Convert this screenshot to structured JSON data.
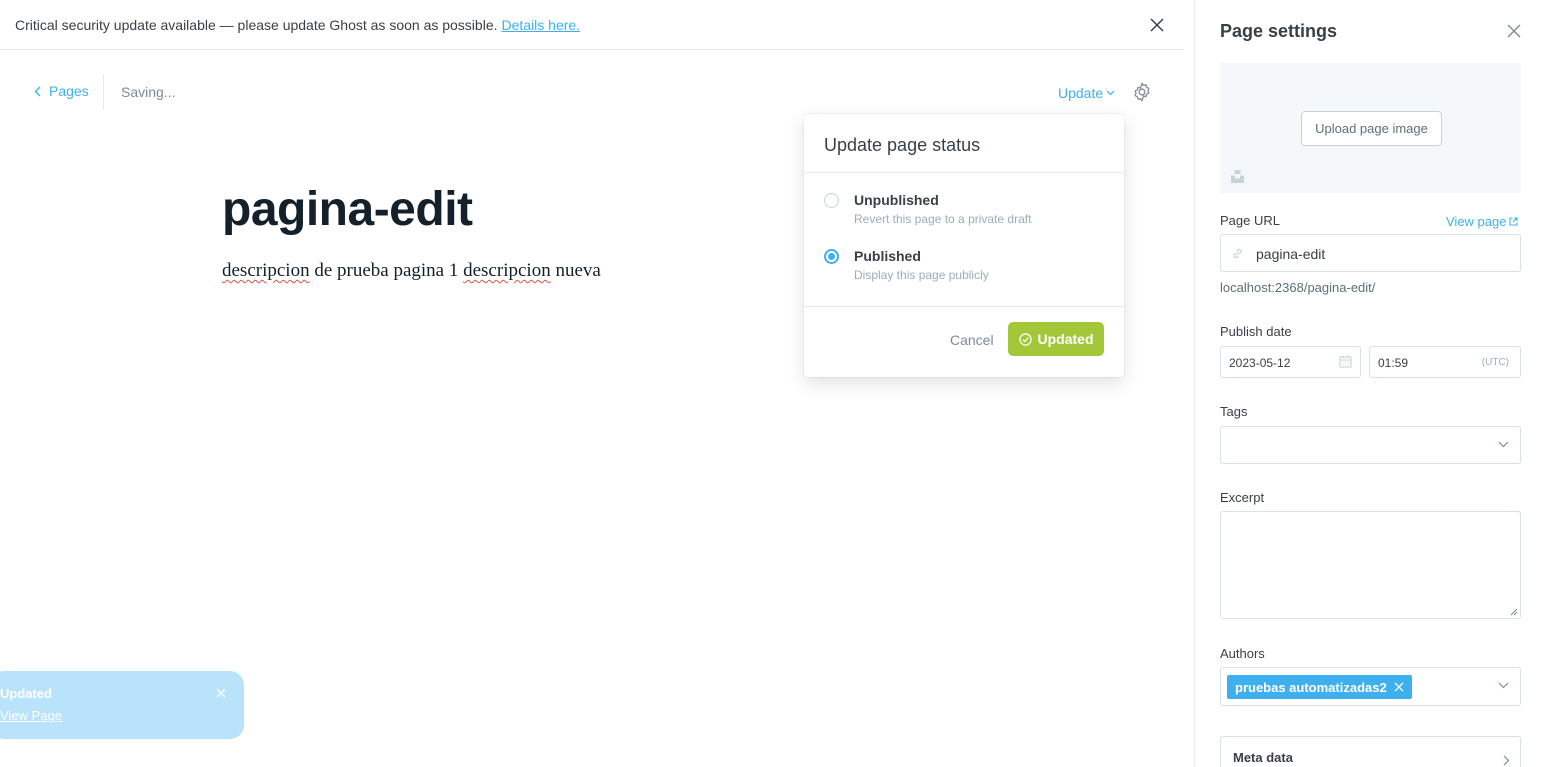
{
  "banner": {
    "message": "Critical security update available — please update Ghost as soon as possible.",
    "link_text": "Details here."
  },
  "editor": {
    "back_label": "Pages",
    "saving_status": "Saving...",
    "update_label": "Update",
    "title": "pagina-edit",
    "body": {
      "w1": "descripcion",
      "w2": " de prueba pagina 1 ",
      "w3": "descripcion",
      "w4": " nueva"
    }
  },
  "popover": {
    "title": "Update page status",
    "options": [
      {
        "label": "Unpublished",
        "description": "Revert this page to a private draft",
        "selected": false
      },
      {
        "label": "Published",
        "description": "Display this page publicly",
        "selected": true
      }
    ],
    "cancel_label": "Cancel",
    "confirm_label": "Updated"
  },
  "toast": {
    "title": "Updated",
    "link": "View Page"
  },
  "settings": {
    "title": "Page settings",
    "upload_label": "Upload page image",
    "url_label": "Page URL",
    "view_page_label": "View page",
    "url_value": "pagina-edit",
    "url_hint": "localhost:2368/pagina-edit/",
    "publish_date_label": "Publish date",
    "date_value": "2023-05-12",
    "time_value": "01:59",
    "timezone": "(UTC)",
    "tags_label": "Tags",
    "excerpt_label": "Excerpt",
    "authors_label": "Authors",
    "author_name": "pruebas automatizadas2",
    "meta_label": "Meta data"
  },
  "colors": {
    "accent": "#3eb0ef",
    "success": "#a4c639",
    "toast_bg": "#b8e3fa"
  }
}
